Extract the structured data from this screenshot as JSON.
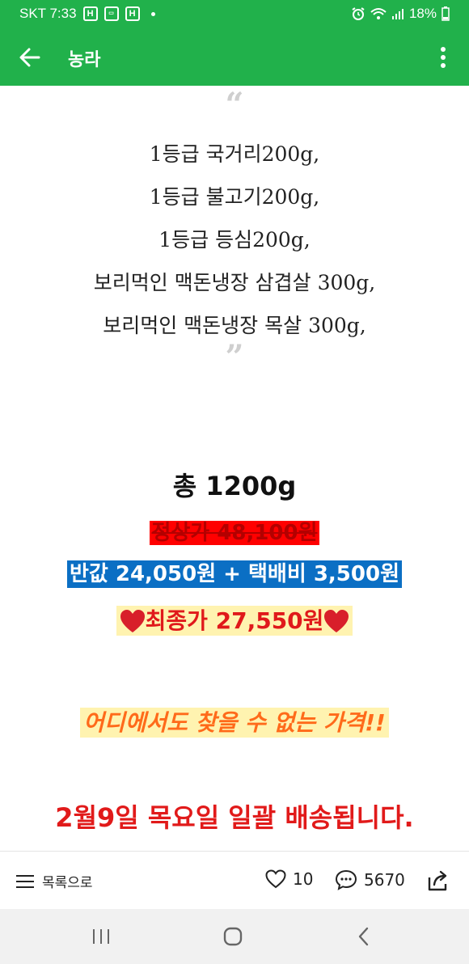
{
  "status_bar": {
    "carrier_time": "SKT 7:33",
    "icons_left": [
      "h-notification-icon",
      "wallet-icon",
      "h-notification-icon"
    ],
    "battery": "18%",
    "icons_right": [
      "alarm-icon",
      "wifi-icon",
      "signal-icon",
      "battery-icon"
    ]
  },
  "app_bar": {
    "title": "농라"
  },
  "post": {
    "poem_lines": [
      "1등급 국거리200g,",
      "1등급 불고기200g,",
      "1등급 등심200g,",
      "보리먹인 맥돈냉장 삼겹살 300g,",
      "보리먹인 맥돈냉장 목살 300g,"
    ],
    "total": "총 1200g",
    "regular_price": "정상가 48,100원",
    "half_price": "반값 24,050원 + 택배비 3,500원",
    "final_price": "최종가 27,550원",
    "slogan": "어디에서도 찾을 수 없는 가격!!",
    "delivery": "2월9일 목요일 일괄 배송됩니다."
  },
  "bottom_bar": {
    "list_label": "목록으로",
    "likes": "10",
    "comments": "5670"
  },
  "colors": {
    "brand_green": "#21b14b",
    "highlight_red": "#ff0000",
    "highlight_blue": "#0b6fc4",
    "highlight_yellow": "#fff3b0",
    "text_red": "#e11a1a",
    "text_orange": "#ff6a1a"
  }
}
